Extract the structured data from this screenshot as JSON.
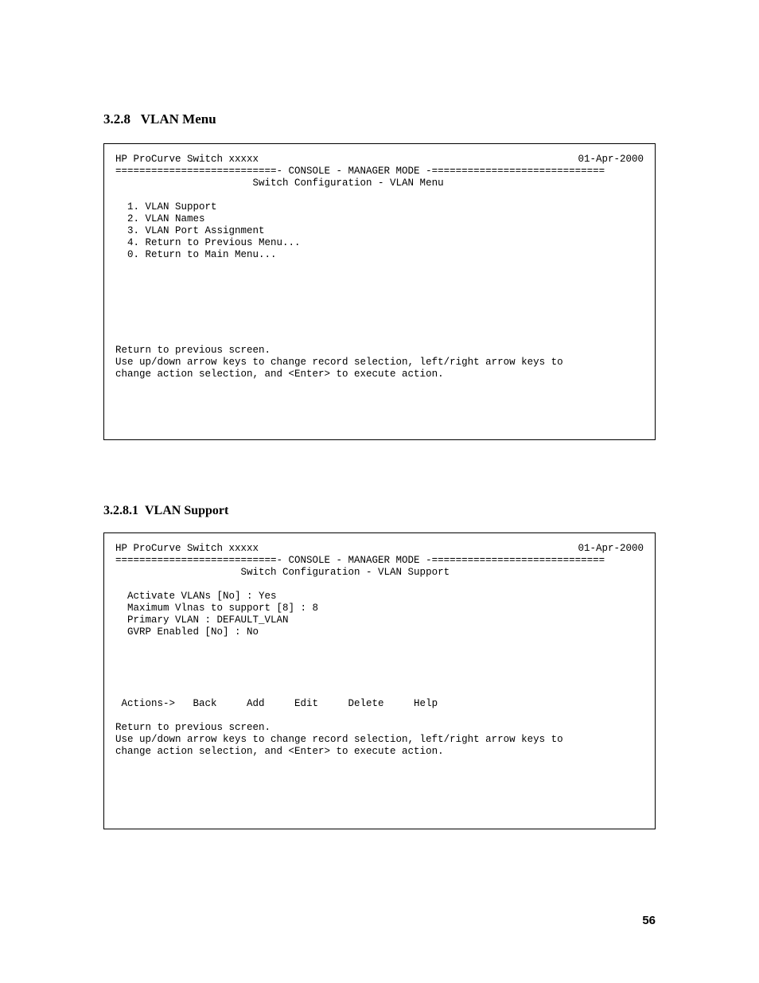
{
  "section1": {
    "number": "3.2.8",
    "title": "VLAN Menu"
  },
  "console1": {
    "device": "HP ProCurve Switch xxxxx",
    "date": "01-Apr-2000",
    "divider": "===========================- CONSOLE - MANAGER MODE -=============================",
    "subtitle": "                       Switch Configuration - VLAN Menu",
    "menu1": "  1. VLAN Support",
    "menu2": "  2. VLAN Names",
    "menu3": "  3. VLAN Port Assignment",
    "menu4": "  4. Return to Previous Menu...",
    "menu0": "  0. Return to Main Menu...",
    "foot1": "Return to previous screen.",
    "foot2": "Use up/down arrow keys to change record selection, left/right arrow keys to",
    "foot3": "change action selection, and <Enter> to execute action."
  },
  "section2": {
    "number": "3.2.8.1",
    "title": "VLAN Support"
  },
  "console2": {
    "device": "HP ProCurve Switch xxxxx",
    "date": "01-Apr-2000",
    "divider": "===========================- CONSOLE - MANAGER MODE -=============================",
    "subtitle": "                     Switch Configuration - VLAN Support",
    "line1": "  Activate VLANs [No] : Yes",
    "line2": "  Maximum Vlnas to support [8] : 8",
    "line3": "  Primary VLAN : DEFAULT_VLAN",
    "line4": "  GVRP Enabled [No] : No",
    "actions": " Actions->   Back     Add     Edit     Delete     Help",
    "foot1": "Return to previous screen.",
    "foot2": "Use up/down arrow keys to change record selection, left/right arrow keys to",
    "foot3": "change action selection, and <Enter> to execute action."
  },
  "pageNumber": "56"
}
